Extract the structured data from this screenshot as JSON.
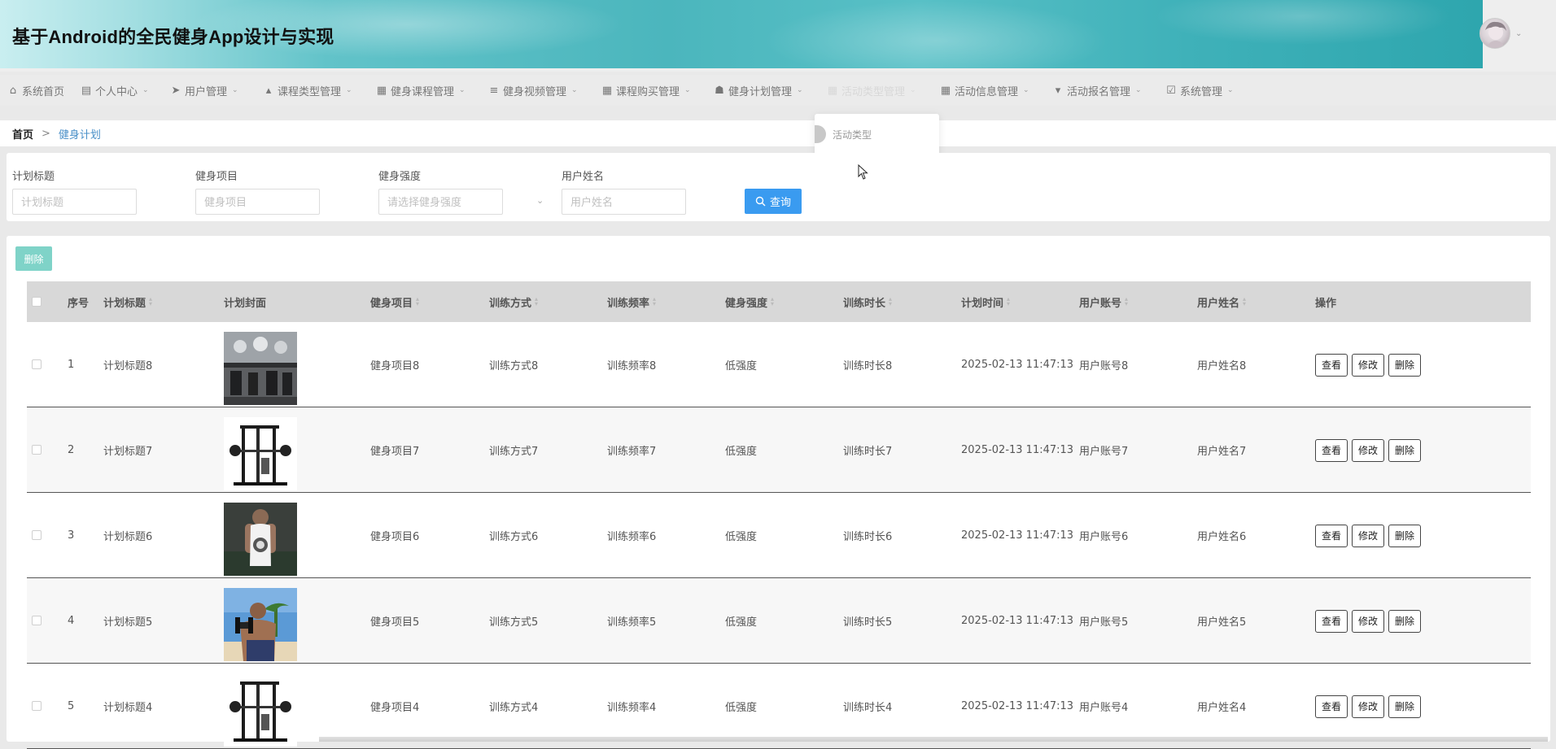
{
  "app": {
    "title": "基于Android的全民健身App设计与实现"
  },
  "nav": {
    "items": [
      {
        "label": "系统首页",
        "icon": "home-icon",
        "glyph": "⌂",
        "has_caret": false
      },
      {
        "label": "个人中心",
        "icon": "card-icon",
        "glyph": "▤",
        "has_caret": true
      },
      {
        "label": "用户管理",
        "icon": "paper-plane-icon",
        "glyph": "➤",
        "has_caret": true
      },
      {
        "label": "课程类型管理",
        "icon": "thumbs-up-icon",
        "glyph": "▴",
        "has_caret": true
      },
      {
        "label": "健身课程管理",
        "icon": "grid-icon",
        "glyph": "▦",
        "has_caret": true
      },
      {
        "label": "健身视频管理",
        "icon": "list-icon",
        "glyph": "≡",
        "has_caret": true
      },
      {
        "label": "课程购买管理",
        "icon": "grid-icon",
        "glyph": "▦",
        "has_caret": true
      },
      {
        "label": "健身计划管理",
        "icon": "user-icon",
        "glyph": "☗",
        "has_caret": true
      },
      {
        "label": "活动类型管理",
        "icon": "grid-icon",
        "glyph": "▦",
        "has_caret": true
      },
      {
        "label": "活动信息管理",
        "icon": "grid-icon",
        "glyph": "▦",
        "has_caret": true
      },
      {
        "label": "活动报名管理",
        "icon": "flag-icon",
        "glyph": "▾",
        "has_caret": true
      },
      {
        "label": "系统管理",
        "icon": "check-square-icon",
        "glyph": "☑",
        "has_caret": true
      }
    ],
    "dropdown": {
      "items": [
        {
          "label": "活动类型"
        }
      ]
    }
  },
  "breadcrumb": {
    "home": "首页",
    "separator": ">",
    "current": "健身计划"
  },
  "search": {
    "fields": [
      {
        "label": "计划标题",
        "placeholder": "计划标题"
      },
      {
        "label": "健身项目",
        "placeholder": "健身项目"
      },
      {
        "label": "健身强度",
        "placeholder": "请选择健身强度"
      },
      {
        "label": "用户姓名",
        "placeholder": "用户姓名"
      }
    ],
    "button_label": "查询"
  },
  "toolbar": {
    "delete_label": "删除"
  },
  "table": {
    "columns": [
      "序号",
      "计划标题",
      "计划封面",
      "健身项目",
      "训练方式",
      "训练频率",
      "健身强度",
      "训练时长",
      "计划时间",
      "用户账号",
      "用户姓名",
      "操作"
    ],
    "actions": [
      "查看",
      "修改",
      "删除"
    ],
    "rows": [
      {
        "index": "1",
        "title": "计划标题8",
        "cover": "gym-interior",
        "project": "健身项目8",
        "method": "训练方式8",
        "frequency": "训练频率8",
        "intensity": "低强度",
        "duration": "训练时长8",
        "time": "2025-02-13 11:47:13",
        "account": "用户账号8",
        "name": "用户姓名8"
      },
      {
        "index": "2",
        "title": "计划标题7",
        "cover": "power-rack",
        "project": "健身项目7",
        "method": "训练方式7",
        "frequency": "训练频率7",
        "intensity": "低强度",
        "duration": "训练时长7",
        "time": "2025-02-13 11:47:13",
        "account": "用户账号7",
        "name": "用户姓名7"
      },
      {
        "index": "3",
        "title": "计划标题6",
        "cover": "athlete-tank-top",
        "project": "健身项目6",
        "method": "训练方式6",
        "frequency": "训练频率6",
        "intensity": "低强度",
        "duration": "训练时长6",
        "time": "2025-02-13 11:47:13",
        "account": "用户账号6",
        "name": "用户姓名6"
      },
      {
        "index": "4",
        "title": "计划标题5",
        "cover": "outdoor-dumbbell",
        "project": "健身项目5",
        "method": "训练方式5",
        "frequency": "训练频率5",
        "intensity": "低强度",
        "duration": "训练时长5",
        "time": "2025-02-13 11:47:13",
        "account": "用户账号5",
        "name": "用户姓名5"
      },
      {
        "index": "5",
        "title": "计划标题4",
        "cover": "power-rack",
        "project": "健身项目4",
        "method": "训练方式4",
        "frequency": "训练频率4",
        "intensity": "低强度",
        "duration": "训练时长4",
        "time": "2025-02-13 11:47:13",
        "account": "用户账号4",
        "name": "用户姓名4"
      }
    ]
  },
  "colors": {
    "accent": "#3a9bf0",
    "delete_button": "#7fd3c8",
    "breadcrumb_current": "#4a90c8",
    "header_banner": "#4bb6bd"
  }
}
